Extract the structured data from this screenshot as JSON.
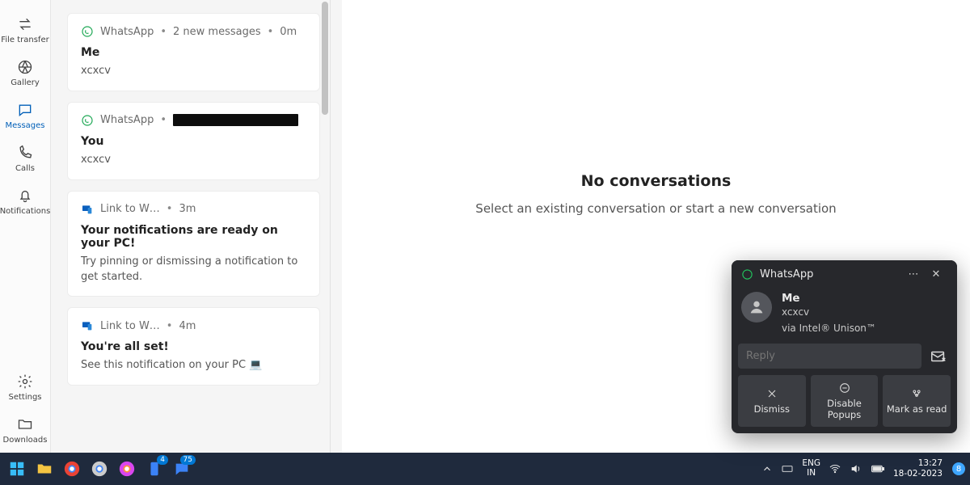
{
  "sidebar": {
    "items": [
      {
        "label": "File transfer"
      },
      {
        "label": "Gallery"
      },
      {
        "label": "Messages"
      },
      {
        "label": "Calls"
      },
      {
        "label": "Notifications"
      },
      {
        "label": "Settings"
      },
      {
        "label": "Downloads"
      }
    ]
  },
  "notifications": [
    {
      "app": "WhatsApp",
      "meta": "2 new messages",
      "time": "0m",
      "title": "Me",
      "body": "xcxcv",
      "icon": "whatsapp"
    },
    {
      "app": "WhatsApp",
      "meta": "[redacted]",
      "time": "",
      "title": "You",
      "body": "xcxcv",
      "icon": "whatsapp"
    },
    {
      "app": "Link to W…",
      "meta": "",
      "time": "3m",
      "title": "Your notifications are ready on your PC!",
      "body": "Try pinning or dismissing a notification to get started.",
      "icon": "link"
    },
    {
      "app": "Link to W…",
      "meta": "",
      "time": "4m",
      "title": "You're all set!",
      "body": "See this notification on your PC 💻",
      "icon": "link"
    }
  ],
  "main": {
    "title": "No conversations",
    "subtitle": "Select an existing conversation or start a new conversation"
  },
  "toast": {
    "app": "WhatsApp",
    "sender": "Me",
    "message": "xcxcv",
    "via": "via Intel® Unison™",
    "reply_placeholder": "Reply",
    "actions": {
      "dismiss": "Dismiss",
      "disable": "Disable Popups",
      "mark": "Mark as read"
    }
  },
  "taskbar": {
    "lang_top": "ENG",
    "lang_bot": "IN",
    "time": "13:27",
    "date": "18-02-2023",
    "notif_count": "8",
    "badges": {
      "phone": "4",
      "chat": "75"
    }
  }
}
